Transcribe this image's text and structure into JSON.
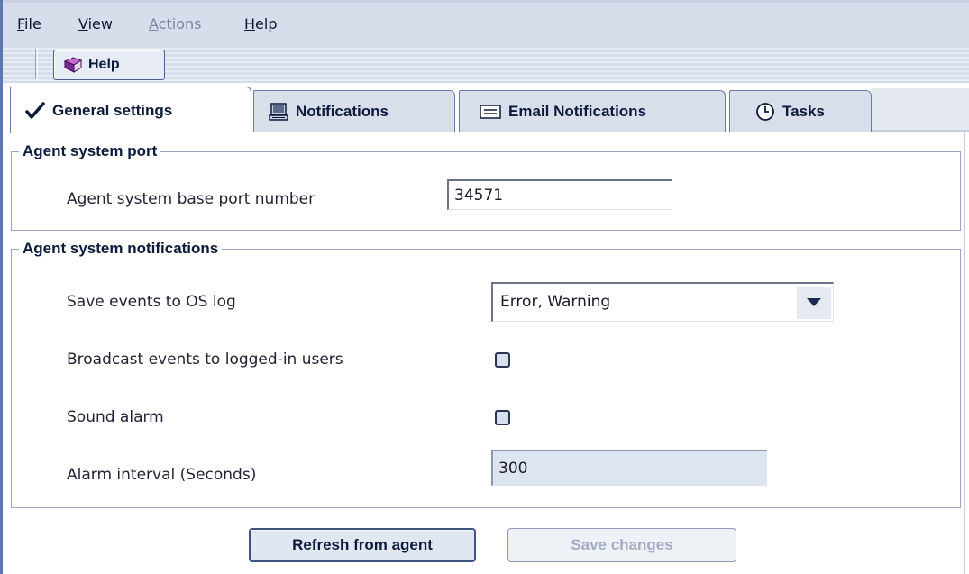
{
  "menu": {
    "file": "File",
    "view": "View",
    "actions": "Actions",
    "help": "Help"
  },
  "toolbar": {
    "help_label": "Help",
    "help_icon": "book-icon"
  },
  "tabs": [
    {
      "label": "General settings",
      "icon": "checkmark-icon",
      "active": true
    },
    {
      "label": "Notifications",
      "icon": "computer-icon",
      "active": false
    },
    {
      "label": "Email Notifications",
      "icon": "envelope-icon",
      "active": false
    },
    {
      "label": "Tasks",
      "icon": "clock-icon",
      "active": false
    }
  ],
  "port_group": {
    "title": "Agent system port",
    "base_port_label": "Agent system base port number",
    "base_port_value": "34571"
  },
  "notifications_group": {
    "title": "Agent system notifications",
    "save_events_label": "Save events to OS log",
    "save_events_value": "Error, Warning",
    "broadcast_label": "Broadcast events to logged-in users",
    "broadcast_checked": false,
    "sound_alarm_label": "Sound alarm",
    "sound_alarm_checked": false,
    "alarm_interval_label": "Alarm interval (Seconds)",
    "alarm_interval_value": "300"
  },
  "actions": {
    "refresh_label": "Refresh from agent",
    "save_label": "Save changes",
    "save_enabled": false
  },
  "colors": {
    "accent_border": "#3f5284",
    "menu_bg": "#d7deeb",
    "tab_bg": "#d8dfeb",
    "disabled_text": "#a3acc2"
  }
}
